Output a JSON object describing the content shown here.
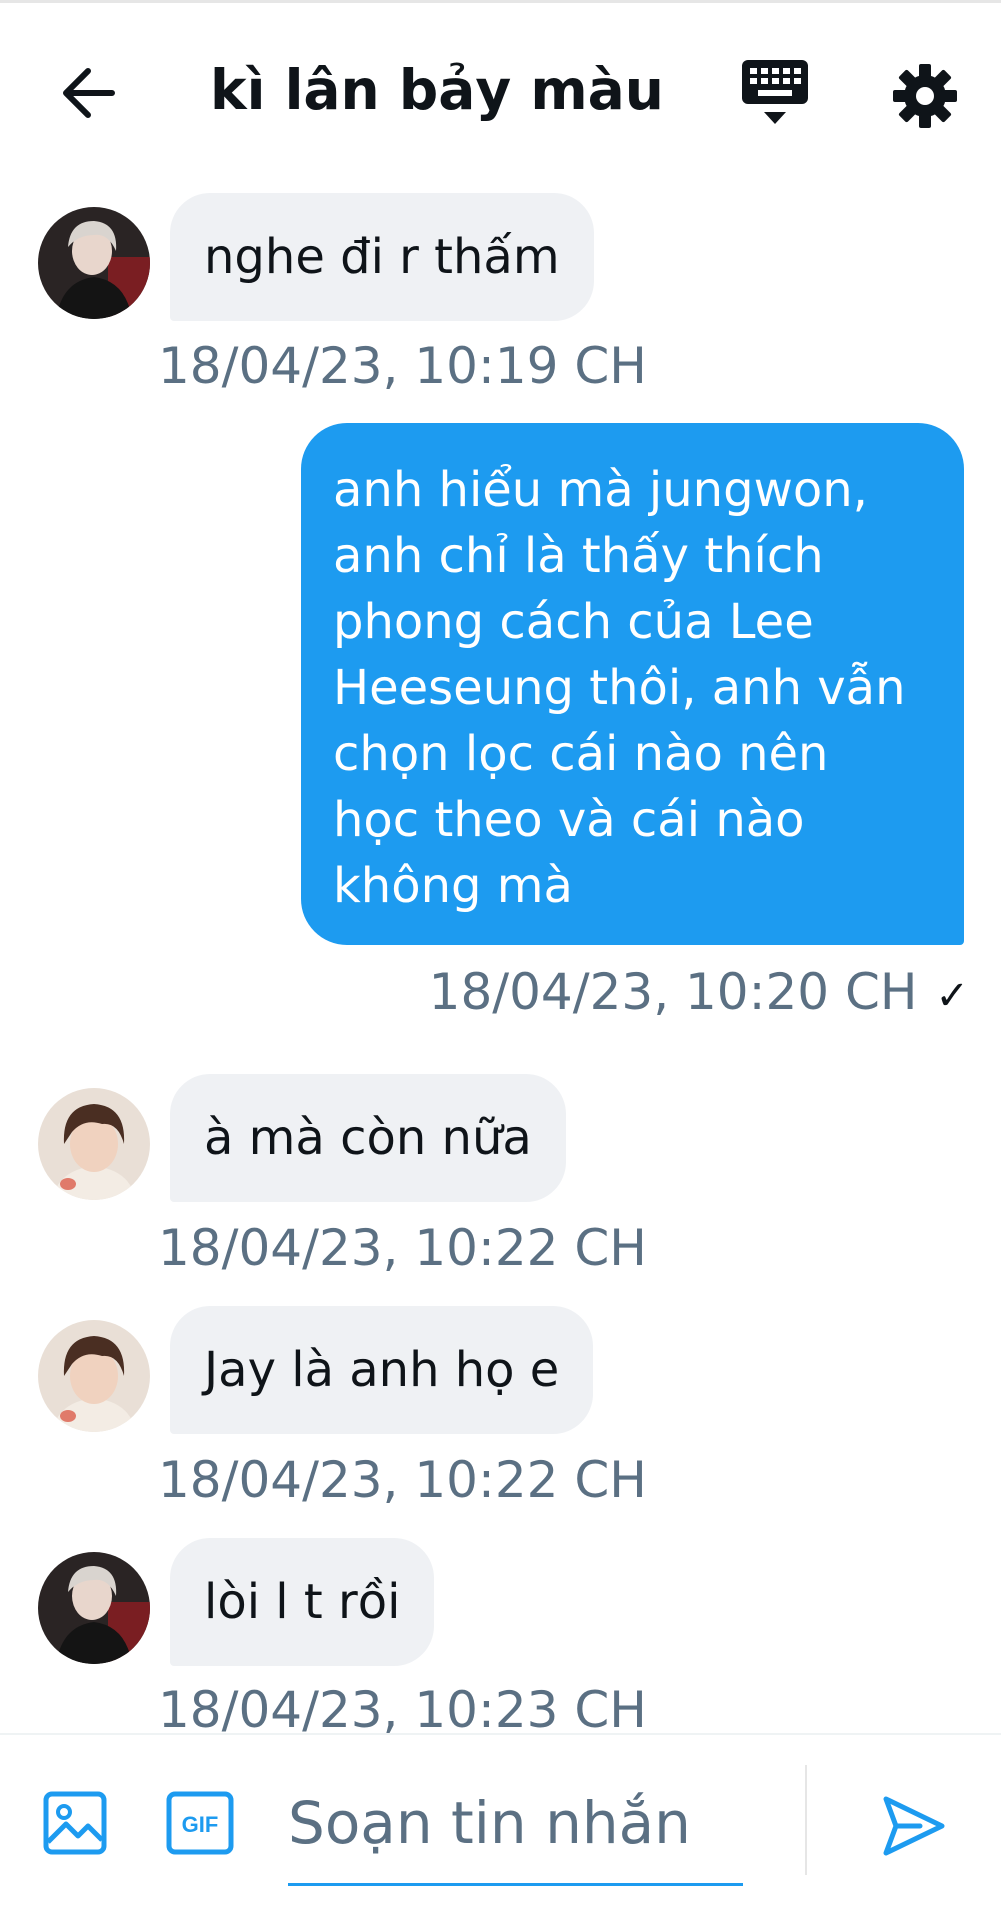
{
  "header": {
    "title": "kì lân bảy màu",
    "icons": {
      "back": "arrow-left-icon",
      "keyboard": "keyboard-icon",
      "settings": "gear-icon"
    }
  },
  "messages": [
    {
      "direction": "incoming",
      "avatar": "avatar-silver-hair",
      "text": "nghe đi r thấm",
      "timestamp": "18/04/23, 10:19 CH"
    },
    {
      "direction": "outgoing",
      "lines": [
        "anh hiểu mà jungwon,",
        "anh chỉ là thấy thích",
        "phong cách của Lee",
        "Heeseung thôi, anh vẫn",
        "chọn lọc cái nào nên",
        "học theo và cái nào",
        "không mà"
      ],
      "timestamp": "18/04/23, 10:20 CH",
      "status": "✓"
    },
    {
      "direction": "incoming",
      "avatar": "avatar-brown-hair",
      "text": "à mà còn nữa",
      "timestamp": "18/04/23, 10:22 CH"
    },
    {
      "direction": "incoming",
      "avatar": "avatar-brown-hair",
      "text": "Jay là anh họ e",
      "timestamp": "18/04/23, 10:22 CH"
    },
    {
      "direction": "incoming",
      "avatar": "avatar-silver-hair",
      "text": "lòi l t rồi",
      "timestamp": "18/04/23, 10:23 CH"
    }
  ],
  "composer": {
    "placeholder": "Soạn tin nhắn",
    "value": "",
    "gif_label": "GIF",
    "icons": {
      "image": "image-icon",
      "gif": "gif-icon",
      "send": "send-icon"
    }
  },
  "colors": {
    "accent": "#1d9bf0",
    "incoming_bubble": "#eff1f4",
    "timestamp": "#5b7083",
    "text": "#0f1419"
  }
}
